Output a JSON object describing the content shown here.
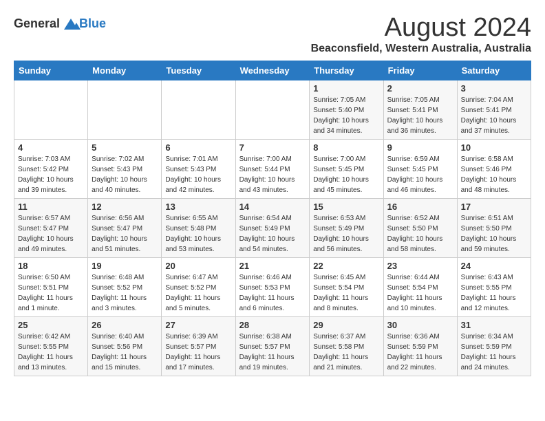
{
  "header": {
    "logo_line1": "General",
    "logo_line2": "Blue",
    "title": "August 2024",
    "subtitle": "Beaconsfield, Western Australia, Australia"
  },
  "weekdays": [
    "Sunday",
    "Monday",
    "Tuesday",
    "Wednesday",
    "Thursday",
    "Friday",
    "Saturday"
  ],
  "weeks": [
    [
      {
        "day": "",
        "sunrise": "",
        "sunset": "",
        "daylight": ""
      },
      {
        "day": "",
        "sunrise": "",
        "sunset": "",
        "daylight": ""
      },
      {
        "day": "",
        "sunrise": "",
        "sunset": "",
        "daylight": ""
      },
      {
        "day": "",
        "sunrise": "",
        "sunset": "",
        "daylight": ""
      },
      {
        "day": "1",
        "sunrise": "Sunrise: 7:05 AM",
        "sunset": "Sunset: 5:40 PM",
        "daylight": "Daylight: 10 hours and 34 minutes."
      },
      {
        "day": "2",
        "sunrise": "Sunrise: 7:05 AM",
        "sunset": "Sunset: 5:41 PM",
        "daylight": "Daylight: 10 hours and 36 minutes."
      },
      {
        "day": "3",
        "sunrise": "Sunrise: 7:04 AM",
        "sunset": "Sunset: 5:41 PM",
        "daylight": "Daylight: 10 hours and 37 minutes."
      }
    ],
    [
      {
        "day": "4",
        "sunrise": "Sunrise: 7:03 AM",
        "sunset": "Sunset: 5:42 PM",
        "daylight": "Daylight: 10 hours and 39 minutes."
      },
      {
        "day": "5",
        "sunrise": "Sunrise: 7:02 AM",
        "sunset": "Sunset: 5:43 PM",
        "daylight": "Daylight: 10 hours and 40 minutes."
      },
      {
        "day": "6",
        "sunrise": "Sunrise: 7:01 AM",
        "sunset": "Sunset: 5:43 PM",
        "daylight": "Daylight: 10 hours and 42 minutes."
      },
      {
        "day": "7",
        "sunrise": "Sunrise: 7:00 AM",
        "sunset": "Sunset: 5:44 PM",
        "daylight": "Daylight: 10 hours and 43 minutes."
      },
      {
        "day": "8",
        "sunrise": "Sunrise: 7:00 AM",
        "sunset": "Sunset: 5:45 PM",
        "daylight": "Daylight: 10 hours and 45 minutes."
      },
      {
        "day": "9",
        "sunrise": "Sunrise: 6:59 AM",
        "sunset": "Sunset: 5:45 PM",
        "daylight": "Daylight: 10 hours and 46 minutes."
      },
      {
        "day": "10",
        "sunrise": "Sunrise: 6:58 AM",
        "sunset": "Sunset: 5:46 PM",
        "daylight": "Daylight: 10 hours and 48 minutes."
      }
    ],
    [
      {
        "day": "11",
        "sunrise": "Sunrise: 6:57 AM",
        "sunset": "Sunset: 5:47 PM",
        "daylight": "Daylight: 10 hours and 49 minutes."
      },
      {
        "day": "12",
        "sunrise": "Sunrise: 6:56 AM",
        "sunset": "Sunset: 5:47 PM",
        "daylight": "Daylight: 10 hours and 51 minutes."
      },
      {
        "day": "13",
        "sunrise": "Sunrise: 6:55 AM",
        "sunset": "Sunset: 5:48 PM",
        "daylight": "Daylight: 10 hours and 53 minutes."
      },
      {
        "day": "14",
        "sunrise": "Sunrise: 6:54 AM",
        "sunset": "Sunset: 5:49 PM",
        "daylight": "Daylight: 10 hours and 54 minutes."
      },
      {
        "day": "15",
        "sunrise": "Sunrise: 6:53 AM",
        "sunset": "Sunset: 5:49 PM",
        "daylight": "Daylight: 10 hours and 56 minutes."
      },
      {
        "day": "16",
        "sunrise": "Sunrise: 6:52 AM",
        "sunset": "Sunset: 5:50 PM",
        "daylight": "Daylight: 10 hours and 58 minutes."
      },
      {
        "day": "17",
        "sunrise": "Sunrise: 6:51 AM",
        "sunset": "Sunset: 5:50 PM",
        "daylight": "Daylight: 10 hours and 59 minutes."
      }
    ],
    [
      {
        "day": "18",
        "sunrise": "Sunrise: 6:50 AM",
        "sunset": "Sunset: 5:51 PM",
        "daylight": "Daylight: 11 hours and 1 minute."
      },
      {
        "day": "19",
        "sunrise": "Sunrise: 6:48 AM",
        "sunset": "Sunset: 5:52 PM",
        "daylight": "Daylight: 11 hours and 3 minutes."
      },
      {
        "day": "20",
        "sunrise": "Sunrise: 6:47 AM",
        "sunset": "Sunset: 5:52 PM",
        "daylight": "Daylight: 11 hours and 5 minutes."
      },
      {
        "day": "21",
        "sunrise": "Sunrise: 6:46 AM",
        "sunset": "Sunset: 5:53 PM",
        "daylight": "Daylight: 11 hours and 6 minutes."
      },
      {
        "day": "22",
        "sunrise": "Sunrise: 6:45 AM",
        "sunset": "Sunset: 5:54 PM",
        "daylight": "Daylight: 11 hours and 8 minutes."
      },
      {
        "day": "23",
        "sunrise": "Sunrise: 6:44 AM",
        "sunset": "Sunset: 5:54 PM",
        "daylight": "Daylight: 11 hours and 10 minutes."
      },
      {
        "day": "24",
        "sunrise": "Sunrise: 6:43 AM",
        "sunset": "Sunset: 5:55 PM",
        "daylight": "Daylight: 11 hours and 12 minutes."
      }
    ],
    [
      {
        "day": "25",
        "sunrise": "Sunrise: 6:42 AM",
        "sunset": "Sunset: 5:55 PM",
        "daylight": "Daylight: 11 hours and 13 minutes."
      },
      {
        "day": "26",
        "sunrise": "Sunrise: 6:40 AM",
        "sunset": "Sunset: 5:56 PM",
        "daylight": "Daylight: 11 hours and 15 minutes."
      },
      {
        "day": "27",
        "sunrise": "Sunrise: 6:39 AM",
        "sunset": "Sunset: 5:57 PM",
        "daylight": "Daylight: 11 hours and 17 minutes."
      },
      {
        "day": "28",
        "sunrise": "Sunrise: 6:38 AM",
        "sunset": "Sunset: 5:57 PM",
        "daylight": "Daylight: 11 hours and 19 minutes."
      },
      {
        "day": "29",
        "sunrise": "Sunrise: 6:37 AM",
        "sunset": "Sunset: 5:58 PM",
        "daylight": "Daylight: 11 hours and 21 minutes."
      },
      {
        "day": "30",
        "sunrise": "Sunrise: 6:36 AM",
        "sunset": "Sunset: 5:59 PM",
        "daylight": "Daylight: 11 hours and 22 minutes."
      },
      {
        "day": "31",
        "sunrise": "Sunrise: 6:34 AM",
        "sunset": "Sunset: 5:59 PM",
        "daylight": "Daylight: 11 hours and 24 minutes."
      }
    ]
  ]
}
